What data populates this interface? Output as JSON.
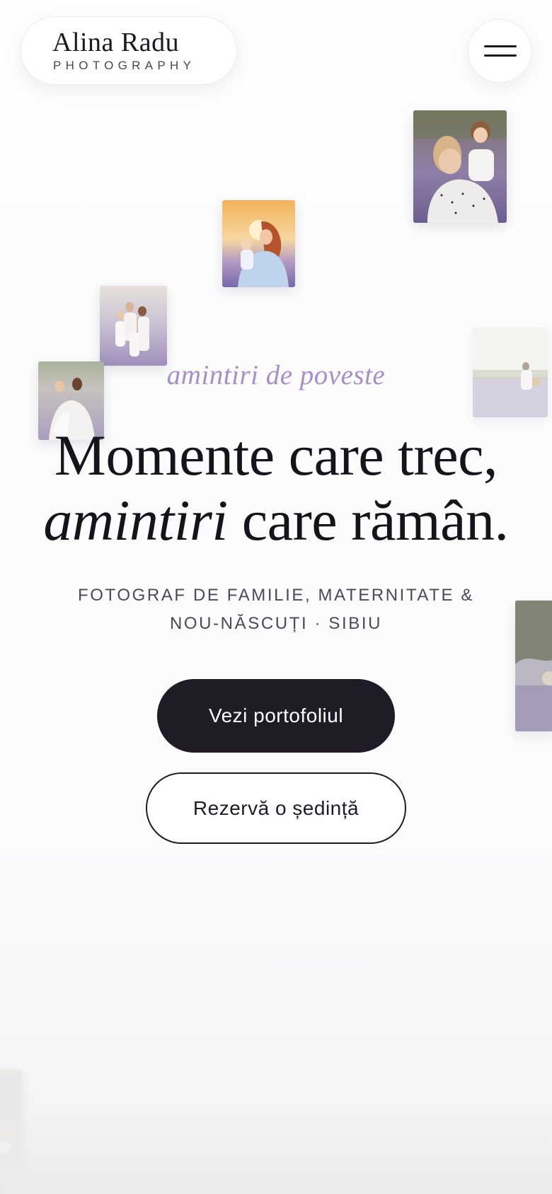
{
  "brand": {
    "name": "Alina Radu",
    "subtitle": "PHOTOGRAPHY"
  },
  "header": {
    "menu_icon": "hamburger-menu-icon"
  },
  "hero": {
    "tagline": "amintiri de poveste",
    "headline_line1": "Momente care trec,",
    "headline_line2_italic": "amintiri",
    "headline_line2_rest": " care rămân.",
    "subtitle": "FOTOGRAF DE FAMILIE, MATERNITATE & NOU-NĂSCUȚI · SIBIU"
  },
  "actions": {
    "primary_label": "Vezi portofoliul",
    "secondary_label": "Rezervă o ședință"
  },
  "colors": {
    "accent_lavender": "#a58fc6",
    "ink": "#1f1b27",
    "background": "#fcfcfd"
  }
}
